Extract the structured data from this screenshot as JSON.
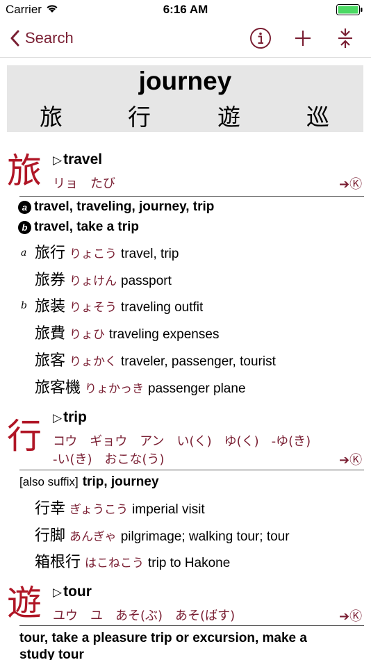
{
  "status": {
    "carrier": "Carrier",
    "time": "6:16 AM"
  },
  "nav": {
    "back_label": "Search"
  },
  "header": {
    "word": "journey",
    "kanji": [
      "旅",
      "行",
      "遊",
      "巡"
    ]
  },
  "entries": [
    {
      "kanji": "旅",
      "meaning": "travel",
      "reading": "リョ　たび",
      "ref": "➔Ⓚ",
      "defs": [
        {
          "badge": "a",
          "text": "travel, traveling, journey, trip"
        },
        {
          "badge": "b",
          "text": "travel, take a trip"
        }
      ],
      "compounds": [
        {
          "sub": "a",
          "word": "旅行",
          "reading": "りょこう",
          "gloss": "travel, trip"
        },
        {
          "sub": "",
          "word": "旅券",
          "reading": "りょけん",
          "gloss": "passport"
        },
        {
          "sub": "b",
          "word": "旅装",
          "reading": "りょそう",
          "gloss": "traveling outfit"
        },
        {
          "sub": "",
          "word": "旅費",
          "reading": "りょひ",
          "gloss": "traveling expenses"
        },
        {
          "sub": "",
          "word": "旅客",
          "reading": "りょかく",
          "gloss": "traveler, passenger, tourist"
        },
        {
          "sub": "",
          "word": "旅客機",
          "reading": "りょかっき",
          "gloss": "passenger plane"
        }
      ]
    },
    {
      "kanji": "行",
      "meaning": "trip",
      "reading1": "コウ　ギョウ　アン　い(く)　ゆ(く)　-ゆ(き)",
      "reading2": "-い(き)　おこな(う)",
      "ref": "➔Ⓚ",
      "def_tag": "[also suffix]",
      "def_text": "trip, journey",
      "compounds": [
        {
          "word": "行幸",
          "reading": "ぎょうこう",
          "gloss": "imperial visit"
        },
        {
          "word": "行脚",
          "reading": "あんぎゃ",
          "gloss": "pilgrimage; walking tour; tour"
        },
        {
          "word": "箱根行",
          "reading": "はこねこう",
          "gloss": "trip to Hakone"
        }
      ]
    },
    {
      "kanji": "遊",
      "meaning": "tour",
      "reading": "ユウ　ユ　あそ(ぶ)　あそ(ばす)",
      "ref": "➔Ⓚ",
      "def_line1": "tour, take a pleasure trip or excursion, make a",
      "def_line2": "study tour"
    }
  ]
}
